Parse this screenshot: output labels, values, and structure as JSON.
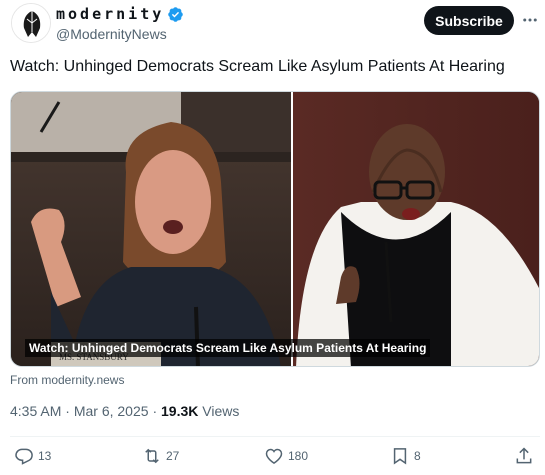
{
  "account": {
    "display_name": "modernity",
    "handle": "@ModernityNews",
    "subscribe_label": "Subscribe"
  },
  "tweet": {
    "text": "Watch: Unhinged Democrats Scream Like Asylum Patients At Hearing",
    "media_caption": "Watch: Unhinged Democrats Scream Like Asylum Patients At Hearing",
    "nameplate_text": "MS. STANSBURY",
    "source": "From modernity.news",
    "time": "4:35 AM",
    "date": "Mar 6, 2025",
    "views_count": "19.3K",
    "views_label": "Views",
    "separator": "·"
  },
  "actions": {
    "replies": "13",
    "reposts": "27",
    "likes": "180",
    "bookmarks": "8"
  },
  "icons": [
    "avatar-logo-icon",
    "verified-badge-icon",
    "more-options-icon",
    "reply-icon",
    "repost-icon",
    "like-icon",
    "bookmark-icon",
    "share-icon"
  ],
  "colors": {
    "verified_blue": "#1d9bf0",
    "text_primary": "#0f1419",
    "text_secondary": "#536471",
    "button_dark": "#0f1419"
  }
}
